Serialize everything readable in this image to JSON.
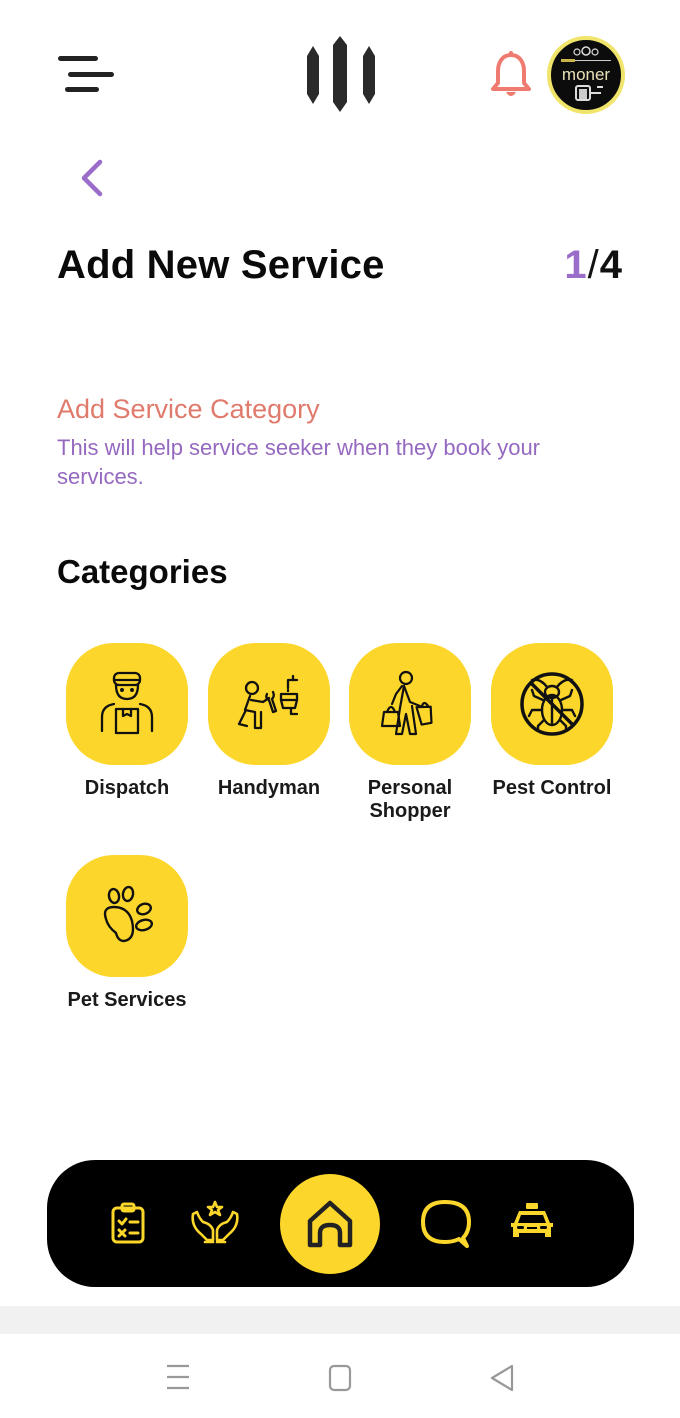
{
  "header": {
    "menu_icon": "hamburger-menu-icon",
    "logo_icon": "app-logo-bars-icon",
    "notification_icon": "bell-icon",
    "avatar_text": "moner",
    "colors": {
      "bell": "#ef7b70",
      "avatar_ring": "#f0e56a"
    }
  },
  "page": {
    "back_icon": "chevron-left-icon",
    "title": "Add New Service",
    "step_current": "1",
    "step_separator": "/",
    "step_total": "4"
  },
  "intro": {
    "title": "Add Service Category",
    "description": "This will help service seeker when they book your services."
  },
  "categories": {
    "title": "Categories",
    "items": [
      {
        "label": "Dispatch",
        "icon": "delivery-man-icon"
      },
      {
        "label": "Handyman",
        "icon": "handyman-plumber-icon"
      },
      {
        "label": "Personal Shopper",
        "icon": "shopper-with-bags-icon"
      },
      {
        "label": "Pest Control",
        "icon": "no-cockroach-icon"
      },
      {
        "label": "Pet Services",
        "icon": "paw-icon"
      }
    ]
  },
  "bottom_nav": {
    "items": [
      {
        "name": "tasks",
        "icon": "clipboard-checklist-icon"
      },
      {
        "name": "services",
        "icon": "hands-star-icon"
      },
      {
        "name": "home",
        "icon": "home-icon",
        "active": true
      },
      {
        "name": "chat",
        "icon": "chat-bubble-icon"
      },
      {
        "name": "ride",
        "icon": "taxi-icon"
      }
    ]
  },
  "system_nav": {
    "items": [
      "recents-icon",
      "home-square-icon",
      "back-triangle-icon"
    ]
  },
  "colors": {
    "accent_yellow": "#fcd62a",
    "accent_purple": "#9b6dcb",
    "accent_coral": "#e07a6c",
    "nav_bg": "#000000"
  }
}
